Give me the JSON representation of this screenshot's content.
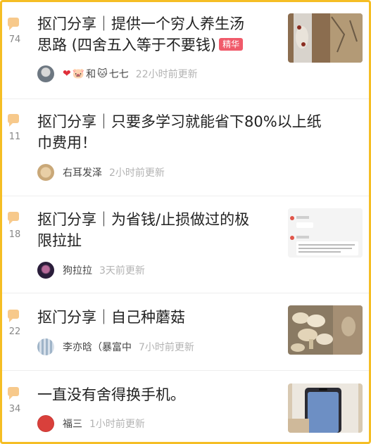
{
  "posts": [
    {
      "count": "74",
      "title_line1": "抠门分享｜提供一个穷人养生汤",
      "title_line2": "思路 (四舍五入等于不要钱)",
      "badge": "精华",
      "author_parts": [
        "❤",
        "🐷",
        "和",
        "🐱",
        "七七"
      ],
      "time": "22小时前更新"
    },
    {
      "count": "11",
      "title_line1": "抠门分享｜只要多学习就能省下80%以上纸",
      "title_line2": "巾费用！",
      "author": "右耳发泽",
      "time": "2小时前更新"
    },
    {
      "count": "18",
      "title_line1": "抠门分享｜为省钱/止损做过的极",
      "title_line2": "限拉扯",
      "author": "狗拉拉",
      "time": "3天前更新"
    },
    {
      "count": "22",
      "title_line1": "抠门分享｜自己种蘑菇",
      "author": "李亦晗（暴富中",
      "time": "7小时前更新"
    },
    {
      "count": "34",
      "title_line1": "一直没有舍得换手机。",
      "author": "福三",
      "time": "1小时前更新"
    }
  ],
  "colors": {
    "border": "#F5BE24",
    "badge": "#F05A6A",
    "comment_icon": "#F7C98B"
  }
}
